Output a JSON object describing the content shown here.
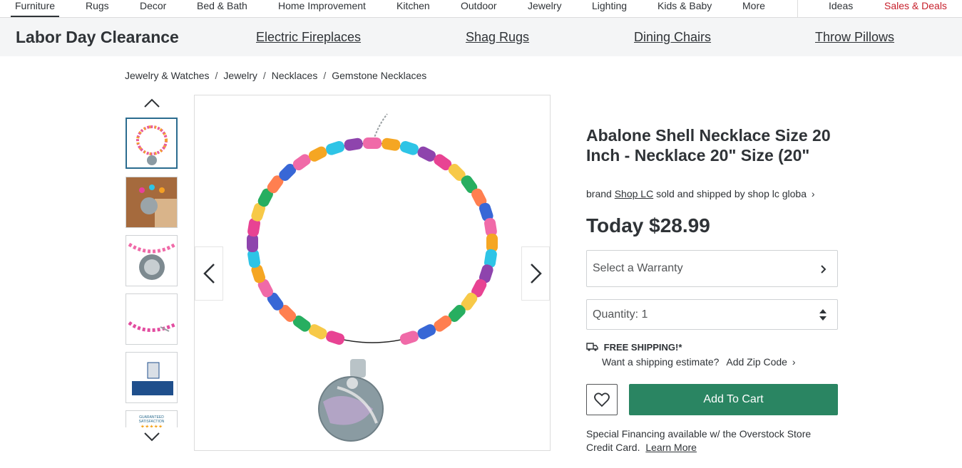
{
  "top_nav": {
    "items": [
      "Furniture",
      "Rugs",
      "Decor",
      "Bed & Bath",
      "Home Improvement",
      "Kitchen",
      "Outdoor",
      "Jewelry",
      "Lighting",
      "Kids & Baby",
      "More"
    ],
    "ideas": "Ideas",
    "sales": "Sales & Deals",
    "active": "Furniture"
  },
  "promo": {
    "title": "Labor Day Clearance",
    "links": [
      "Electric Fireplaces",
      "Shag Rugs",
      "Dining Chairs",
      "Throw Pillows"
    ]
  },
  "breadcrumb": [
    "Jewelry & Watches",
    "Jewelry",
    "Necklaces",
    "Gemstone Necklaces"
  ],
  "product": {
    "title": "Abalone Shell Necklace Size 20 Inch - Necklace 20\" Size (20\"",
    "brand_prefix": "brand",
    "brand": "Shop LC",
    "seller_text": "sold and shipped by shop lc globa",
    "price": "Today $28.99",
    "warranty_label": "Select a Warranty",
    "quantity_label": "Quantity: 1",
    "free_shipping": "FREE SHIPPING!*",
    "shipping_estimate": "Want a shipping estimate?",
    "add_zip": "Add Zip Code",
    "add_to_cart": "Add To Cart",
    "financing_text": "Special Financing available w/ the Overstock Store Credit Card.",
    "learn_more": "Learn More"
  },
  "thumbnails": {
    "badge_text": "GUARANTEED SATISFACTION"
  },
  "colors": {
    "accent_green": "#2a8562",
    "sales_red": "#c7202c",
    "selected_thumb_border": "#2b6c8f"
  }
}
